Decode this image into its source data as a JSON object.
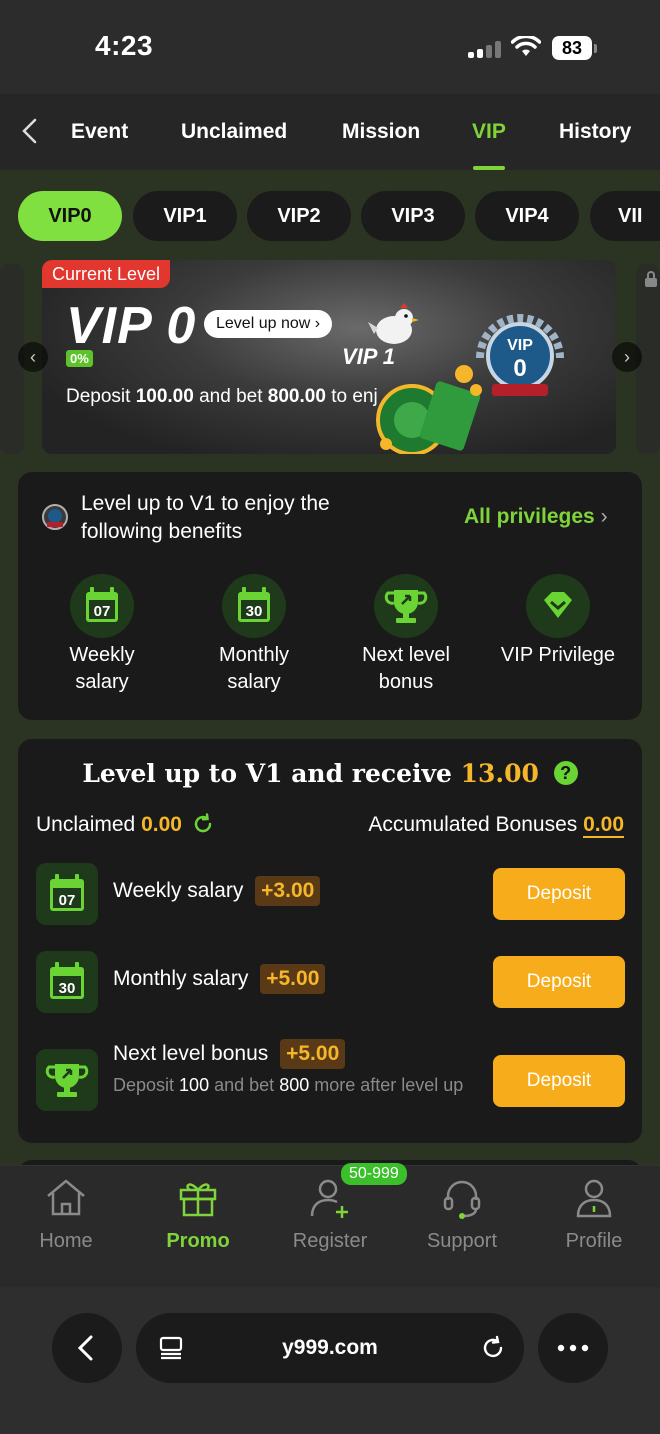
{
  "status": {
    "time": "4:23",
    "battery": "83"
  },
  "tabs": [
    {
      "label": "Event"
    },
    {
      "label": "Unclaimed"
    },
    {
      "label": "Mission"
    },
    {
      "label": "VIP"
    },
    {
      "label": "History"
    }
  ],
  "vip_levels": [
    "VIP0",
    "VIP1",
    "VIP2",
    "VIP3",
    "VIP4",
    "VII"
  ],
  "banner": {
    "current_level": "Current Level",
    "level": "VIP 0",
    "level_up_now": "Level up now",
    "progress": "0%",
    "next_level": "VIP 1",
    "deposit_prefix": "Deposit",
    "deposit_amount": "100.00",
    "deposit_mid": "and bet",
    "bet_amount": "800.00",
    "deposit_suffix": "to enj"
  },
  "benefits": {
    "title_line1": "Level up to V1 to enjoy the",
    "title_line2": "following benefits",
    "all_privileges": "All privileges",
    "items": [
      {
        "line1": "Weekly",
        "line2": "salary",
        "icon": "calendar-07-icon",
        "num": "07"
      },
      {
        "line1": "Monthly",
        "line2": "salary",
        "icon": "calendar-30-icon",
        "num": "30"
      },
      {
        "line1": "Next level",
        "line2": "bonus",
        "icon": "trophy-icon"
      },
      {
        "line1": "VIP Privilege",
        "line2": "",
        "icon": "diamond-icon"
      }
    ]
  },
  "rewards": {
    "title": "Level up to V1 and receive",
    "title_amount": "13.00",
    "unclaimed_label": "Unclaimed",
    "unclaimed_value": "0.00",
    "accumulated_label": "Accumulated Bonuses",
    "accumulated_value": "0.00",
    "rows": [
      {
        "label": "Weekly salary",
        "amount": "+3.00",
        "button": "Deposit",
        "num": "07"
      },
      {
        "label": "Monthly salary",
        "amount": "+5.00",
        "button": "Deposit",
        "num": "30"
      },
      {
        "label": "Next level bonus",
        "amount": "+5.00",
        "button": "Deposit"
      }
    ],
    "bonus_sub": {
      "p1": "Deposit",
      "v1": "100",
      "p2": "and bet",
      "v2": "800",
      "p3": "more after level up"
    }
  },
  "bottom_nav": [
    {
      "label": "Home"
    },
    {
      "label": "Promo"
    },
    {
      "label": "Register",
      "badge": "50-999"
    },
    {
      "label": "Support"
    },
    {
      "label": "Profile"
    }
  ],
  "browser": {
    "url": "y999.com"
  },
  "colors": {
    "accent": "#7fd43a",
    "gold": "#f5b729",
    "button": "#f7ad1b",
    "badge_red": "#e2372f"
  }
}
